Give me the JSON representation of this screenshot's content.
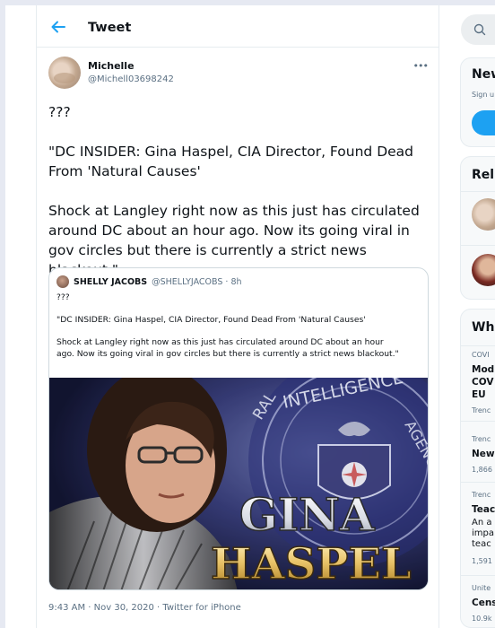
{
  "header": {
    "title": "Tweet"
  },
  "tweet": {
    "author_name": "Michelle",
    "author_handle": "@Michell03698242",
    "more": "•••",
    "text": "???\n\n\"DC INSIDER: Gina Haspel, CIA Director, Found Dead From 'Natural Causes'\n\nShock at Langley right now as this just has circulated around DC about an hour ago. Now its going viral in gov circles but there is currently a strict news blackout.\"",
    "timestamp": "9:43 AM · Nov 30, 2020 · Twitter for iPhone"
  },
  "quote": {
    "author_name": "SHELLY JACOBS",
    "author_handle": "@SHELLYJACOBS · 8h",
    "text": "???\n\n\"DC INSIDER: Gina Haspel, CIA Director, Found Dead From 'Natural Causes'\n\nShock at Langley right now as this just has circulated around DC about an hour\nago. Now its going viral in gov circles but there is currently a strict news blackout.\"",
    "image": {
      "ring_text": "CENTRAL INTELLIGENCE AGENCY",
      "ring_left": "RAL",
      "ring_top": "INTELLIGENCE",
      "ring_right": "AGENCY",
      "title_line1": "GINA",
      "title_line2": "HASPEL"
    }
  },
  "right_sidebar": {
    "new_title": "New",
    "new_sub": "Sign u",
    "related_title": "Rel",
    "whats_title": "Wh",
    "trends": [
      {
        "meta": "COVI",
        "line1": "Mod",
        "line2": "COV",
        "line3": "EU",
        "foot": "Trenc"
      },
      {
        "meta": "Trenc",
        "line1": "New",
        "foot": "1,866"
      },
      {
        "meta": "Trenc",
        "line1": "Teac",
        "line2": "An a",
        "line3": "impa",
        "line4": "teac",
        "foot": "1,591"
      },
      {
        "meta": "Unite",
        "line1": "Cens",
        "foot": "10.9k"
      }
    ]
  },
  "colors": {
    "accent": "#1da1f2",
    "muted": "#5b7083",
    "border": "#e6ecf0",
    "text": "#0f1419"
  }
}
